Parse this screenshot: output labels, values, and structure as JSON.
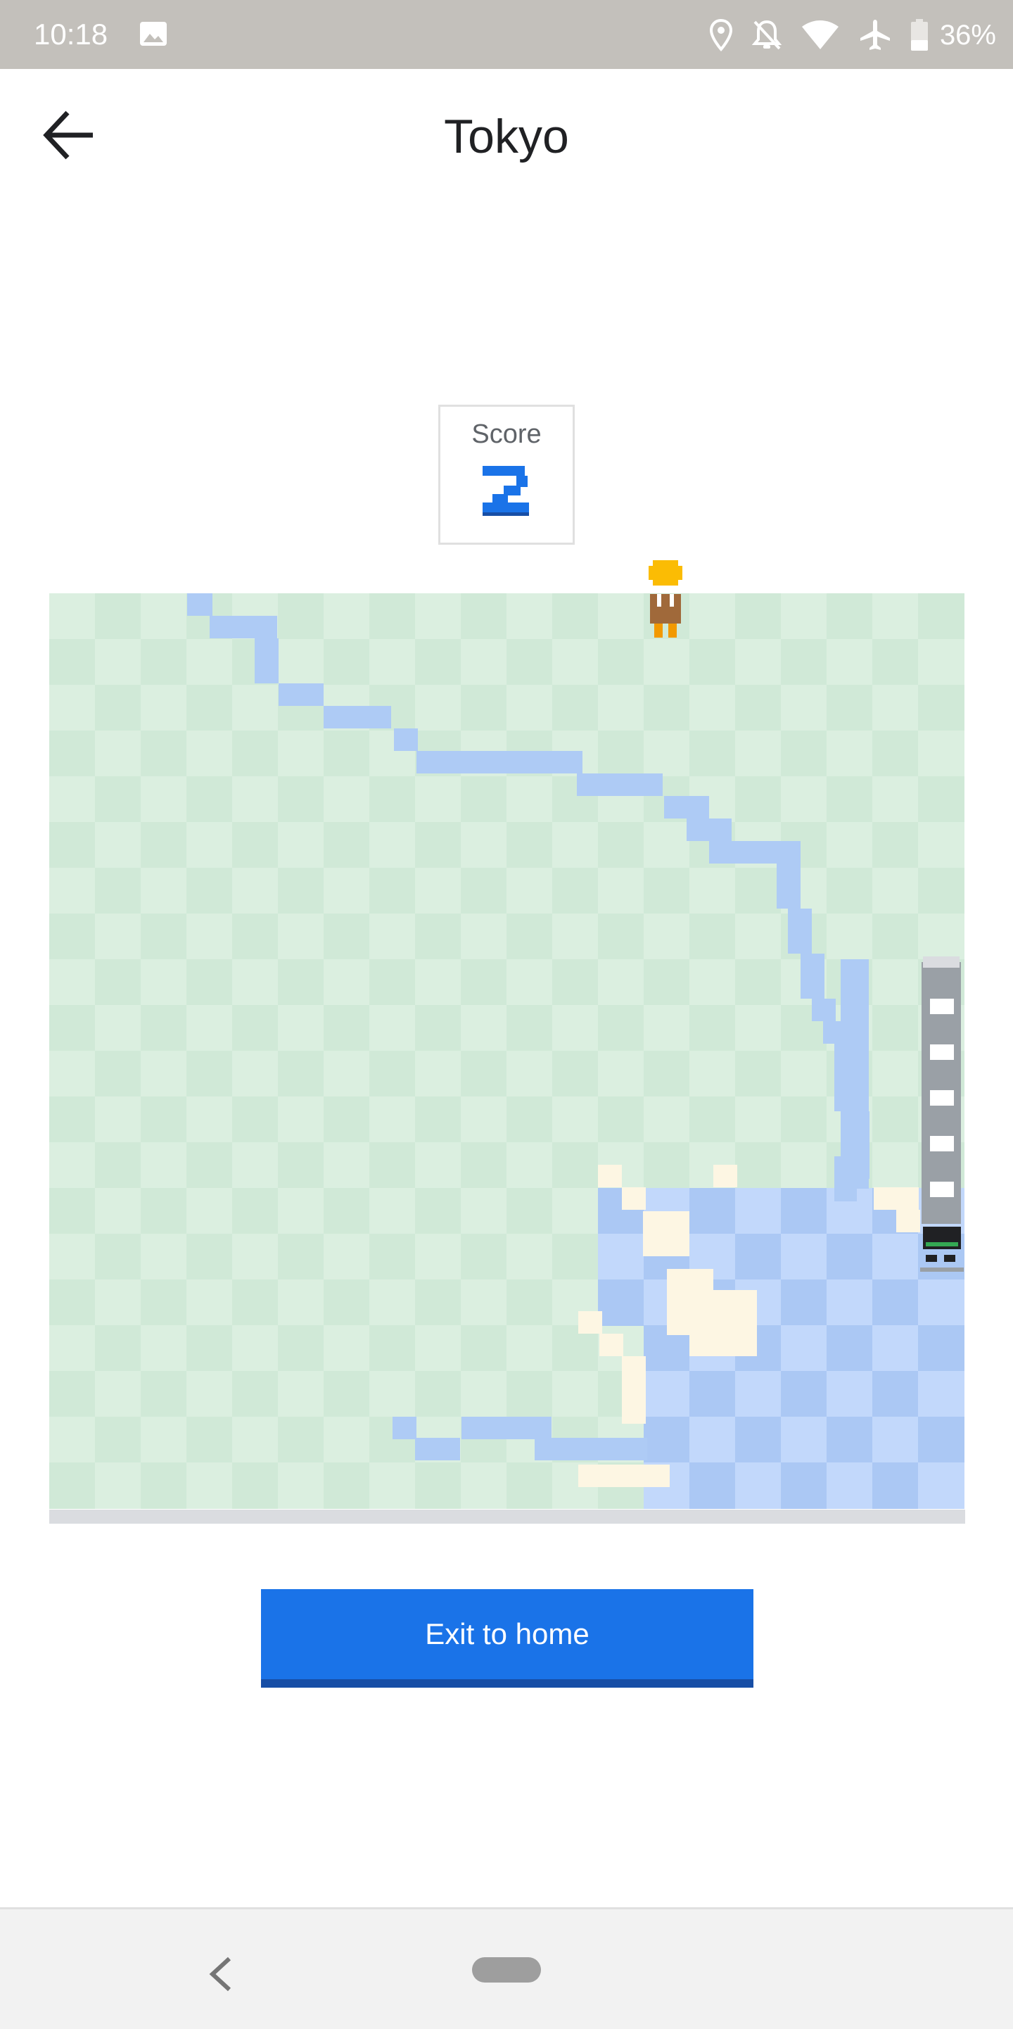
{
  "status_bar": {
    "time": "10:18",
    "battery_text": "36%",
    "icons": [
      "gallery-icon",
      "location-icon",
      "bell-off-icon",
      "wifi-icon",
      "airplane-icon",
      "battery-icon"
    ]
  },
  "header": {
    "title": "Tokyo",
    "back_icon": "arrow-left-icon"
  },
  "score": {
    "label": "Score",
    "value": "2"
  },
  "game": {
    "colors": {
      "grass_light": "#dbefe0",
      "grass_dark": "#d0e9d7",
      "river": "#aecbf5",
      "water_light": "#c2d8fb",
      "water_dark": "#abc8f4",
      "sand": "#fdf6e3",
      "track": "#9aa0a6"
    },
    "player": "pixel-character",
    "train": "train-snake"
  },
  "exit_button": {
    "label": "Exit to home"
  },
  "nav_bar": {
    "icons": [
      "nav-back-icon",
      "nav-home-pill"
    ]
  }
}
